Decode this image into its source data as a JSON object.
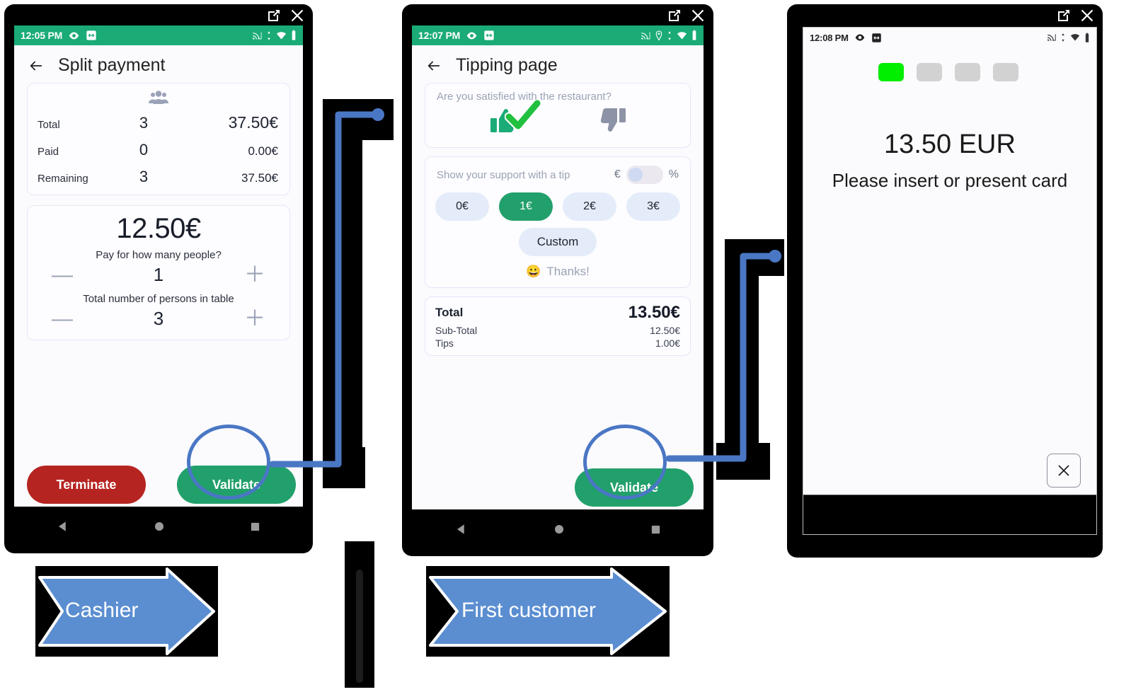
{
  "window_controls": {
    "popout_icon": "open-in-new-icon",
    "close_icon": "close-icon"
  },
  "cashier_phone": {
    "status_bar": {
      "time": "12:05 PM",
      "left_icons": [
        "eye-icon",
        "resize-box-icon"
      ],
      "right_icons": [
        "cast-icon",
        "sync-icon",
        "wifi-icon",
        "battery-icon"
      ]
    },
    "app_bar": {
      "back_icon": "back-arrow-icon",
      "title": "Split payment"
    },
    "summary_card": {
      "icon": "people-group-icon",
      "rows": [
        {
          "label": "Total",
          "count": "3",
          "amount": "37.50€",
          "emphasis": "big"
        },
        {
          "label": "Paid",
          "count": "0",
          "amount": "0.00€",
          "emphasis": "sm"
        },
        {
          "label": "Remaining",
          "count": "3",
          "amount": "37.50€",
          "emphasis": "sm"
        }
      ]
    },
    "amount_card": {
      "amount": "12.50€",
      "people_label": "Pay for how many people?",
      "people_value": "1",
      "table_label": "Total number of persons in table",
      "table_value": "3",
      "minus": "—",
      "plus": "＋"
    },
    "buttons": {
      "terminate": "Terminate",
      "validate": "Validate"
    },
    "nav_bar": [
      "back-triangle-icon",
      "home-circle-icon",
      "recents-square-icon"
    ]
  },
  "customer_phone": {
    "status_bar": {
      "time": "12:07 PM",
      "left_icons": [
        "eye-icon",
        "resize-box-icon"
      ],
      "right_icons": [
        "cast-icon",
        "location-icon",
        "sync-icon",
        "wifi-icon",
        "battery-icon"
      ]
    },
    "app_bar": {
      "back_icon": "back-arrow-icon",
      "title": "Tipping page"
    },
    "satisfaction": {
      "question": "Are you satisfied with the restaurant?",
      "thumbs_up": "thumbs-up-icon",
      "thumbs_down": "thumbs-down-icon",
      "selected": "thumbs-up"
    },
    "tip": {
      "prompt": "Show your support with a tip",
      "currency_symbol": "€",
      "percent_symbol": "%",
      "toggle_state": "currency",
      "options": [
        "0€",
        "1€",
        "2€",
        "3€"
      ],
      "selected_option": "1€",
      "custom_label": "Custom",
      "thanks_emoji": "😀",
      "thanks_text": "Thanks!"
    },
    "totals": {
      "total_label": "Total",
      "total_value": "13.50€",
      "lines": [
        {
          "label": "Sub-Total",
          "value": "12.50€"
        },
        {
          "label": "Tips",
          "value": "1.00€"
        }
      ]
    },
    "buttons": {
      "validate": "Validate"
    },
    "nav_bar": [
      "back-triangle-icon",
      "home-circle-icon",
      "recents-square-icon"
    ]
  },
  "terminal": {
    "status_bar": {
      "time": "12:08 PM",
      "left_icons": [
        "eye-icon",
        "resize-box-icon"
      ],
      "right_icons": [
        "cast-icon",
        "sync-icon",
        "wifi-icon",
        "battery-icon"
      ]
    },
    "progress_dots": {
      "count": 4,
      "active_index": 0,
      "active_color": "#00ee00",
      "inactive_color": "#d2d2d2"
    },
    "amount": "13.50 EUR",
    "message": "Please insert or present card",
    "close_icon": "close-icon"
  },
  "annotations": {
    "circle_color": "#4a77c4",
    "connector_color": "#4a77c4",
    "arrows": [
      {
        "label": "Cashier",
        "color": "#5b8ed1"
      },
      {
        "label": "First customer",
        "color": "#5b8ed1"
      }
    ]
  }
}
